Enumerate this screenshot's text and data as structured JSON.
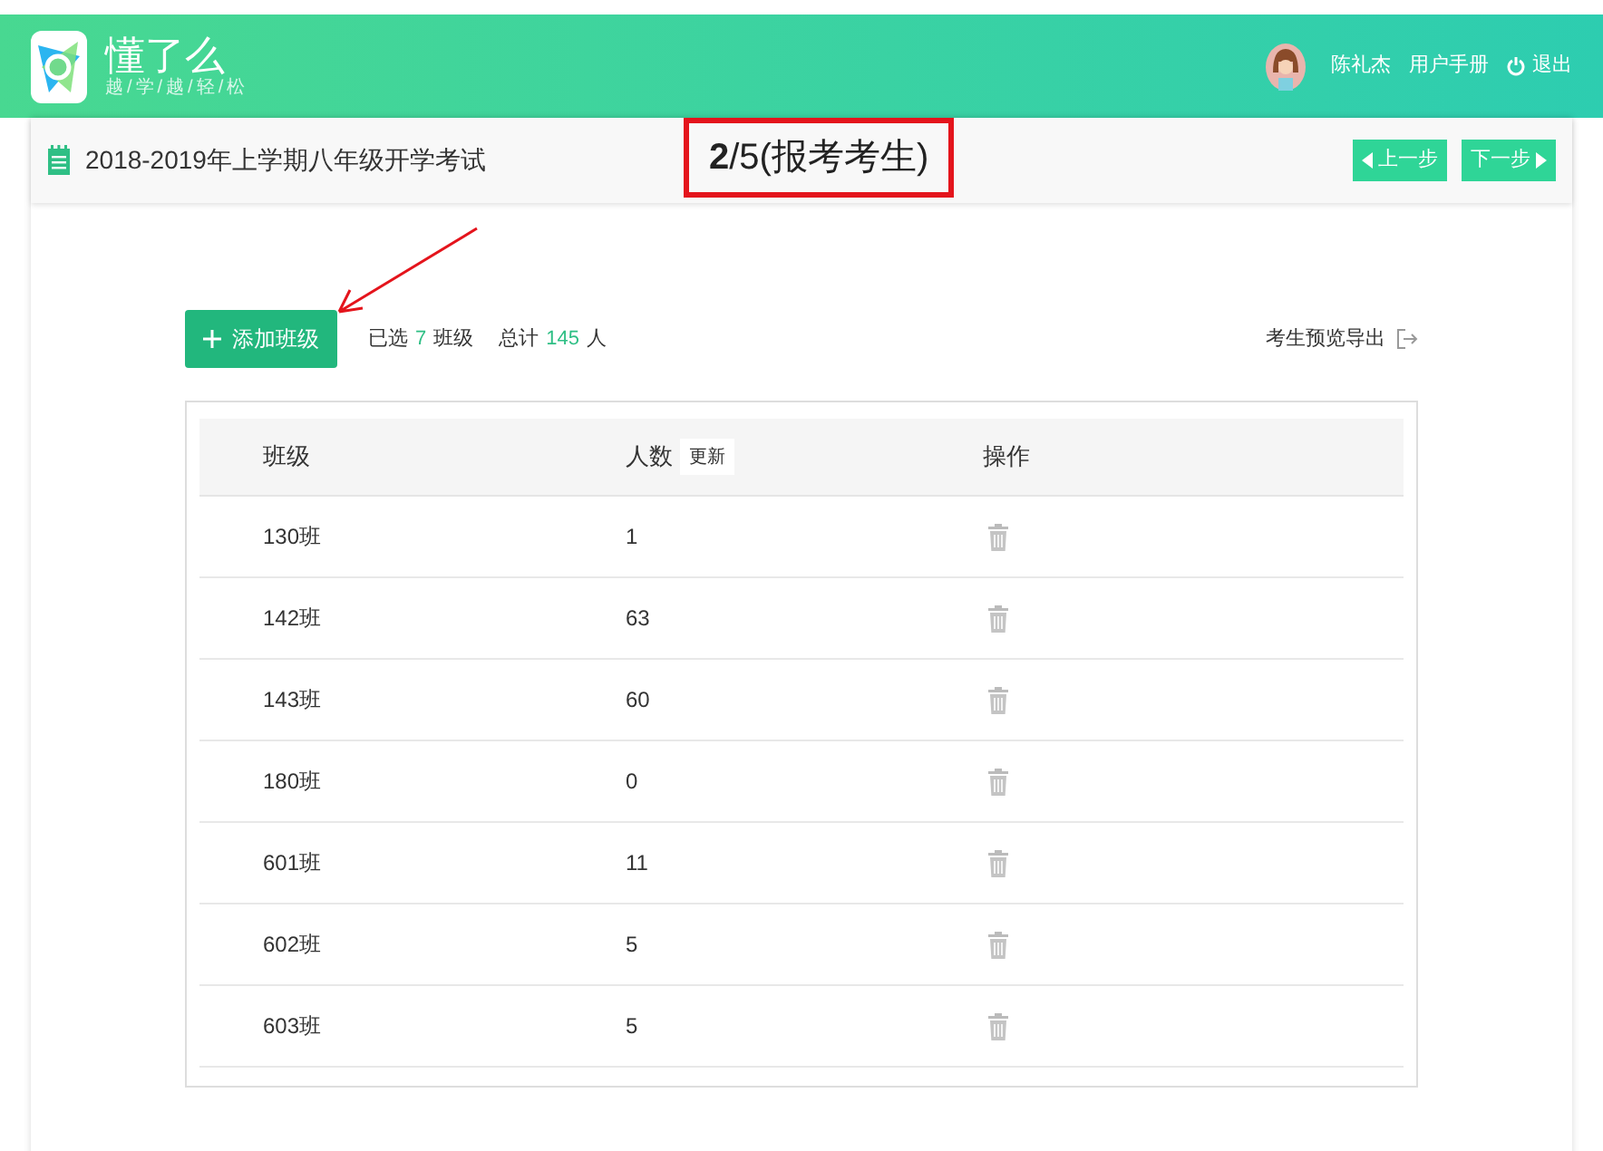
{
  "header": {
    "logo_title": "懂了么",
    "logo_slogan": "越/学/越/轻/松",
    "user_name": "陈礼杰",
    "links": [
      "用户手册",
      "退出"
    ]
  },
  "toolbar": {
    "exam_title": "2018-2019年上学期八年级开学考试",
    "step": "**2**/5(报考考生)",
    "prev": "上一步",
    "next": "下一步"
  },
  "actions": {
    "add_button": "添加班级",
    "selected_label": "已选",
    "selected_count": "7",
    "selected_unit": "班级",
    "total_label": "总计",
    "total_count": "145",
    "total_unit": "人",
    "export": "考生预览导出"
  },
  "table": {
    "columns": [
      "班级",
      "人数",
      "操作"
    ],
    "refresh": "更新",
    "rows": [
      {
        "class": "130班",
        "count": "1"
      },
      {
        "class": "142班",
        "count": "63"
      },
      {
        "class": "143班",
        "count": "60"
      },
      {
        "class": "180班",
        "count": "0"
      },
      {
        "class": "601班",
        "count": "11"
      },
      {
        "class": "602班",
        "count": "5"
      },
      {
        "class": "603班",
        "count": "5"
      }
    ]
  }
}
